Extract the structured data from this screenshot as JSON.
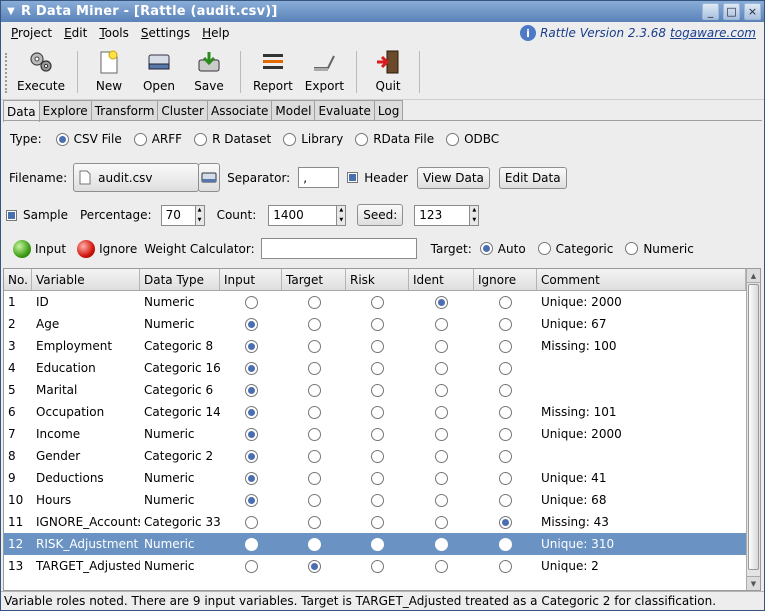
{
  "window": {
    "title": "R Data Miner - [Rattle (audit.csv)]",
    "controls": [
      "_",
      "□",
      "×"
    ]
  },
  "menu": {
    "items": [
      {
        "pre": "",
        "u": "P",
        "post": "roject"
      },
      {
        "pre": "",
        "u": "E",
        "post": "dit"
      },
      {
        "pre": "",
        "u": "T",
        "post": "ools"
      },
      {
        "pre": "",
        "u": "S",
        "post": "ettings"
      },
      {
        "pre": "",
        "u": "H",
        "post": "elp"
      }
    ],
    "version_text": "Rattle Version 2.3.68",
    "version_link": "togaware.com"
  },
  "toolbar": {
    "execute": "Execute",
    "new": "New",
    "open": "Open",
    "save": "Save",
    "report": "Report",
    "export": "Export",
    "quit": "Quit"
  },
  "tabs": [
    "Data",
    "Explore",
    "Transform",
    "Cluster",
    "Associate",
    "Model",
    "Evaluate",
    "Log"
  ],
  "source": {
    "type_label": "Type:",
    "options": [
      "CSV File",
      "ARFF",
      "R Dataset",
      "Library",
      "RData File",
      "ODBC"
    ],
    "selected": 0
  },
  "file": {
    "filename_label": "Filename:",
    "filename": "audit.csv",
    "separator_label": "Separator:",
    "separator": ",",
    "header_label": "Header",
    "view_data": "View Data",
    "edit_data": "Edit Data"
  },
  "sample": {
    "sample_label": "Sample",
    "percentage_label": "Percentage:",
    "percentage": "70",
    "count_label": "Count:",
    "count": "1400",
    "seed_button": "Seed:",
    "seed": "123"
  },
  "roles": {
    "input_label": "Input",
    "ignore_label": "Ignore",
    "weight_label": "Weight Calculator:",
    "weight_value": "",
    "target_label": "Target:",
    "target_options": [
      "Auto",
      "Categoric",
      "Numeric"
    ],
    "target_selected": 0
  },
  "table": {
    "columns": [
      "No.",
      "Variable",
      "Data Type",
      "Input",
      "Target",
      "Risk",
      "Ident",
      "Ignore",
      "Comment"
    ],
    "rows": [
      {
        "no": "1",
        "variable": "ID",
        "type": "Numeric",
        "role": "ident",
        "comment": "Unique: 2000"
      },
      {
        "no": "2",
        "variable": "Age",
        "type": "Numeric",
        "role": "input",
        "comment": "Unique: 67"
      },
      {
        "no": "3",
        "variable": "Employment",
        "type": "Categoric 8",
        "role": "input",
        "comment": "Missing: 100"
      },
      {
        "no": "4",
        "variable": "Education",
        "type": "Categoric 16",
        "role": "input",
        "comment": ""
      },
      {
        "no": "5",
        "variable": "Marital",
        "type": "Categoric 6",
        "role": "input",
        "comment": ""
      },
      {
        "no": "6",
        "variable": "Occupation",
        "type": "Categoric 14",
        "role": "input",
        "comment": "Missing: 101"
      },
      {
        "no": "7",
        "variable": "Income",
        "type": "Numeric",
        "role": "input",
        "comment": "Unique: 2000"
      },
      {
        "no": "8",
        "variable": "Gender",
        "type": "Categoric 2",
        "role": "input",
        "comment": ""
      },
      {
        "no": "9",
        "variable": "Deductions",
        "type": "Numeric",
        "role": "input",
        "comment": "Unique: 41"
      },
      {
        "no": "10",
        "variable": "Hours",
        "type": "Numeric",
        "role": "input",
        "comment": "Unique: 68"
      },
      {
        "no": "11",
        "variable": "IGNORE_Accounts",
        "type": "Categoric 33",
        "role": "ignore",
        "comment": "Missing: 43"
      },
      {
        "no": "12",
        "variable": "RISK_Adjustment",
        "type": "Numeric",
        "role": "risk",
        "comment": "Unique: 310",
        "selected": true
      },
      {
        "no": "13",
        "variable": "TARGET_Adjusted",
        "type": "Numeric",
        "role": "target",
        "comment": "Unique: 2"
      }
    ]
  },
  "status": "Variable roles noted. There are 9 input variables. Target is TARGET_Adjusted treated as a Categoric 2 for classification.",
  "colors": {
    "selection": "#6a92c2",
    "titlebar": "#6f95c8",
    "radio_on": "#4a6fb0"
  }
}
